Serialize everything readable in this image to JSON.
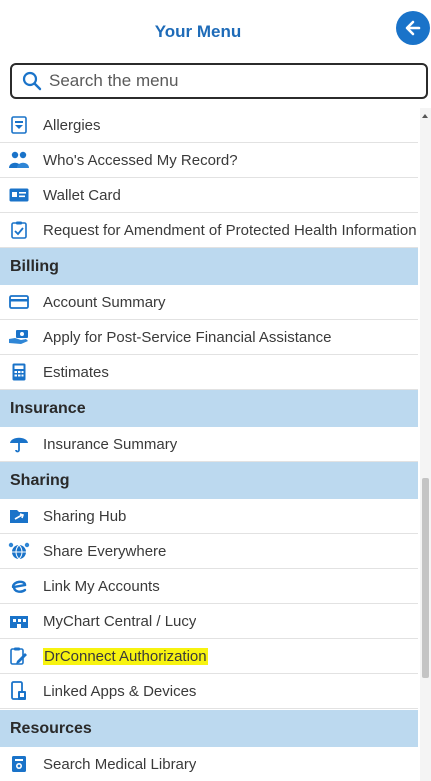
{
  "header": {
    "title": "Your Menu"
  },
  "search": {
    "placeholder": "Search the menu"
  },
  "items": {
    "allergies": "Allergies",
    "whos_accessed": "Who's Accessed My Record?",
    "wallet_card": "Wallet Card",
    "amendment": "Request for Amendment of Protected Health Information",
    "account_summary": "Account Summary",
    "financial_assistance": "Apply for Post-Service Financial Assistance",
    "estimates": "Estimates",
    "insurance_summary": "Insurance Summary",
    "sharing_hub": "Sharing Hub",
    "share_everywhere": "Share Everywhere",
    "link_accounts": "Link My Accounts",
    "mychart_central": "MyChart Central / Lucy",
    "drconnect": "DrConnect Authorization",
    "linked_apps": "Linked Apps & Devices",
    "medical_library": "Search Medical Library"
  },
  "sections": {
    "billing": "Billing",
    "insurance": "Insurance",
    "sharing": "Sharing",
    "resources": "Resources"
  },
  "highlighted_item": "DrConnect Authorization",
  "colors": {
    "accent": "#1a73c9",
    "title": "#1e6bb8",
    "section_bg": "#bcd9ef",
    "highlight": "#f7f310"
  }
}
